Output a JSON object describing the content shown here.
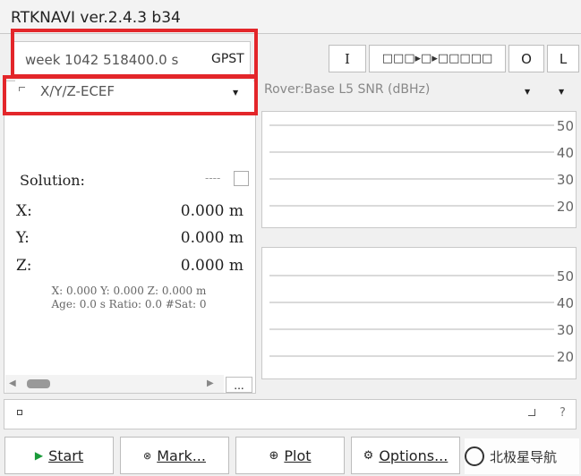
{
  "window": {
    "title": "RTKNAVI ver.2.4.3 b34"
  },
  "time": {
    "text": "week 1042 518400.0 s",
    "system": "GPST"
  },
  "toolbar": {
    "input_label": "I",
    "output_label": "O",
    "log_label": "L",
    "stream_indicator": "□□□▸□▸□□□□□"
  },
  "solution_panel": {
    "coord_type": "X/Y/Z-ECEF",
    "solution_label": "Solution:",
    "solution_status": "----",
    "rows": [
      {
        "label": "X:",
        "value": "0.000 m"
      },
      {
        "label": "Y:",
        "value": "0.000 m"
      },
      {
        "label": "Z:",
        "value": "0.000 m"
      }
    ],
    "summary_line1": "X: 0.000 Y: 0.000 Z: 0.000 m",
    "summary_line2": "Age: 0.0 s Ratio: 0.0 #Sat: 0",
    "more_label": "..."
  },
  "chart_data": [
    {
      "type": "bar",
      "title": "Rover:Base L5 SNR (dBHz)",
      "ylabel": "",
      "yticks": [
        "50",
        "40",
        "30",
        "20"
      ],
      "ylim": [
        10,
        55
      ],
      "categories": [],
      "values": []
    },
    {
      "type": "bar",
      "title": "",
      "ylabel": "",
      "yticks": [
        "50",
        "40",
        "30",
        "20"
      ],
      "ylim": [
        10,
        55
      ],
      "categories": [],
      "values": []
    }
  ],
  "statusbar": {
    "help": "?"
  },
  "buttons": {
    "start": "Start",
    "mark": "Mark...",
    "plot": "Plot",
    "options": "Options..."
  },
  "watermark": {
    "text": "北极星导航"
  },
  "colors": {
    "highlight_red": "#e3262a",
    "start_green": "#1a9b3a"
  }
}
